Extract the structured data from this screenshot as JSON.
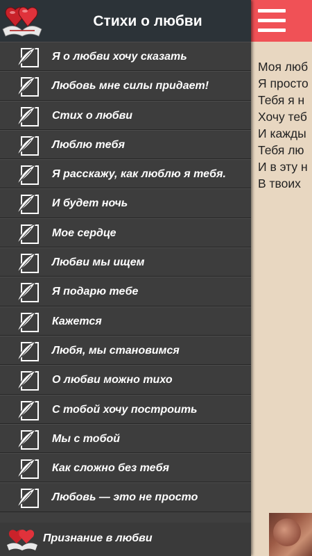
{
  "header": {
    "title": "Стихи о любви"
  },
  "menu": {
    "items": [
      {
        "label": "Я о любви хочу сказать"
      },
      {
        "label": "Любовь мне силы придает!"
      },
      {
        "label": "Стих о любви"
      },
      {
        "label": "Люблю тебя"
      },
      {
        "label": "Я расскажу, как люблю я тебя."
      },
      {
        "label": "И будет ночь"
      },
      {
        "label": "Мое сердце"
      },
      {
        "label": "Любви мы ищем"
      },
      {
        "label": "Я подарю тебе"
      },
      {
        "label": "Кажется"
      },
      {
        "label": "Любя, мы становимся"
      },
      {
        "label": "О любви можно тихо"
      },
      {
        "label": "С тобой хочу построить"
      },
      {
        "label": "Мы с тобой"
      },
      {
        "label": "Как сложно без тебя"
      },
      {
        "label": "Любовь — это не просто"
      }
    ],
    "bottom_item": {
      "label": "Признание в любви"
    }
  },
  "content": {
    "poem_lines": [
      "Моя люб",
      "Я просто",
      "Тебя я н",
      "Хочу теб",
      "И кажды",
      "Тебя лю",
      "И в эту н",
      "В твоих"
    ]
  },
  "colors": {
    "toolbar": "#f05156",
    "drawer": "#3d3d3d",
    "header": "#2c3338",
    "content_bg": "#e8d7c1"
  },
  "icons": {
    "menu": "hamburger-icon",
    "item": "quill-note-icon",
    "logo": "hearts-logo-icon"
  }
}
